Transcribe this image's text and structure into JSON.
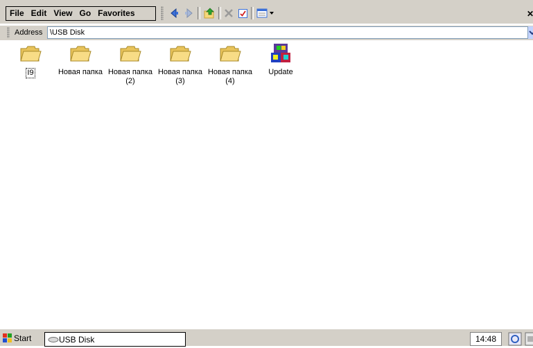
{
  "menu": {
    "file": "File",
    "edit": "Edit",
    "view": "View",
    "go": "Go",
    "favorites": "Favorites"
  },
  "toolbar": {
    "icons": [
      "back-icon",
      "forward-icon",
      "up-folder-icon",
      "delete-icon",
      "properties-icon",
      "view-menu-icon",
      "close-icon"
    ]
  },
  "address": {
    "label": "Address",
    "value": "\\USB Disk"
  },
  "items": [
    {
      "label": "I9",
      "type": "folder",
      "selected": true
    },
    {
      "label": "Новая папка",
      "type": "folder"
    },
    {
      "label": "Новая папка (2)",
      "type": "folder"
    },
    {
      "label": "Новая папка (3)",
      "type": "folder"
    },
    {
      "label": "Новая папка (4)",
      "type": "folder"
    },
    {
      "label": "Update",
      "type": "program"
    }
  ],
  "taskbar": {
    "start": "Start",
    "task": "USB Disk",
    "clock": "14:48"
  },
  "colors": {
    "toolbar_bg": "#d4d0c8",
    "folder": "#f6d77a",
    "folder_dark": "#c9a23a"
  }
}
